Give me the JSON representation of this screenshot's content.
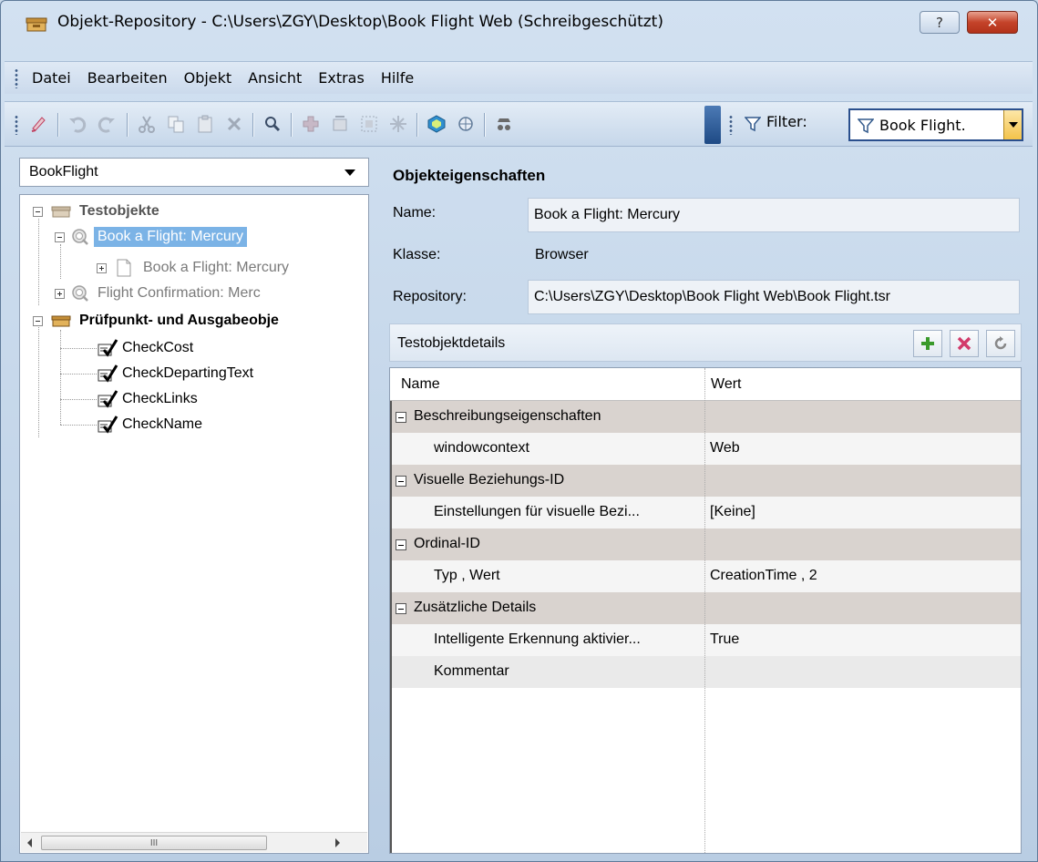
{
  "window": {
    "title": "Objekt-Repository - C:\\Users\\ZGY\\Desktop\\Book Flight Web (Schreibgeschützt)",
    "help_glyph": "?",
    "close_glyph": "✕"
  },
  "menu": {
    "items": [
      "Datei",
      "Bearbeiten",
      "Objekt",
      "Ansicht",
      "Extras",
      "Hilfe"
    ]
  },
  "toolbar": {
    "icons": [
      "highlight-icon",
      "undo-icon",
      "redo-icon",
      "cut-icon",
      "copy-icon",
      "paste-icon",
      "delete-icon",
      "find-icon",
      "add-objects-icon",
      "update-from-app-icon",
      "merge-icon",
      "star-icon",
      "object-spy-icon",
      "locate-icon",
      "spy-icon"
    ],
    "filter_label": "Filter:",
    "filter_value": "Book Flight."
  },
  "left": {
    "combo_value": "BookFlight",
    "tree": {
      "testobjekte": "Testobjekte",
      "book_flight_page": "Book a Flight: Mercury",
      "book_flight_child": "Book a Flight: Mercury",
      "flight_confirmation": "Flight Confirmation: Merc",
      "checkpoints_root": "Prüfpunkt- und Ausgabeobje",
      "checkpoints": [
        "CheckCost",
        "CheckDepartingText",
        "CheckLinks",
        "CheckName"
      ]
    },
    "scroll_thumb_glyph": "III"
  },
  "right": {
    "section_title": "Objekteigenschaften",
    "name_label": "Name:",
    "name_value": "Book a Flight: Mercury",
    "class_label": "Klasse:",
    "class_value": "Browser",
    "repo_label": "Repository:",
    "repo_value": "C:\\Users\\ZGY\\Desktop\\Book Flight Web\\Book Flight.tsr",
    "details_title": "Testobjektdetails",
    "grid": {
      "col_name": "Name",
      "col_value": "Wert",
      "rows": [
        {
          "type": "category",
          "name": "Beschreibungseigenschaften",
          "value": ""
        },
        {
          "type": "property",
          "name": "windowcontext",
          "value": "Web"
        },
        {
          "type": "category",
          "name": "Visuelle Beziehungs-ID",
          "value": ""
        },
        {
          "type": "property",
          "name": "Einstellungen für visuelle Bezi...",
          "value": "[Keine]"
        },
        {
          "type": "category",
          "name": "Ordinal-ID",
          "value": ""
        },
        {
          "type": "property",
          "name": "Typ , Wert",
          "value": "CreationTime , 2"
        },
        {
          "type": "category",
          "name": "Zusätzliche Details",
          "value": ""
        },
        {
          "type": "property",
          "name": "Intelligente Erkennung aktivier...",
          "value": "True"
        },
        {
          "type": "property-alt",
          "name": "Kommentar",
          "value": ""
        }
      ]
    }
  }
}
